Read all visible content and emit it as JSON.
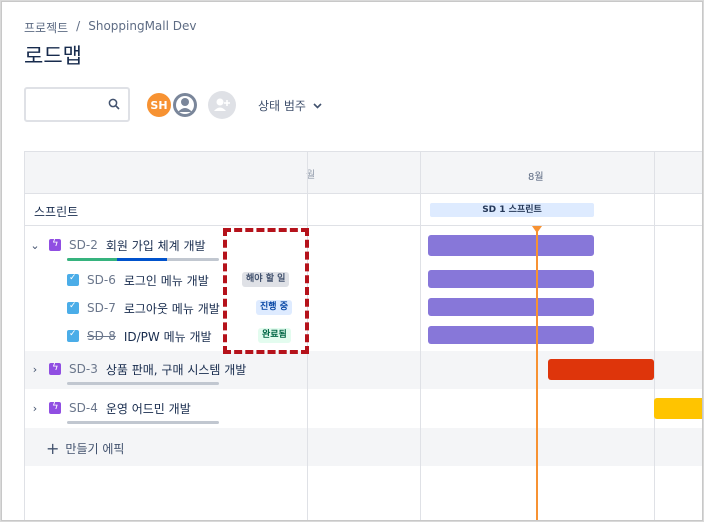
{
  "breadcrumb": {
    "project": "프로젝트",
    "separator": "/",
    "name": "ShoppingMall Dev"
  },
  "page_title": "로드맵",
  "search": {
    "placeholder": ""
  },
  "avatars": {
    "initials": "SH"
  },
  "filter": {
    "status_label": "상태 범주"
  },
  "timeline": {
    "month_partial": "월",
    "month": "8월"
  },
  "sprint": {
    "label": "스프린트",
    "chip": "SD 1 스프린트"
  },
  "epics": [
    {
      "key": "SD-2",
      "name": "회원 가입 체계 개발",
      "expanded": true,
      "bar_color": "#8777d9"
    },
    {
      "key": "SD-3",
      "name": "상품 판매, 구매 시스템 개발",
      "expanded": false,
      "bar_color": "#de350b"
    },
    {
      "key": "SD-4",
      "name": "운영 어드민 개발",
      "expanded": false,
      "bar_color": "#ffc400"
    }
  ],
  "issues": [
    {
      "key": "SD-6",
      "name": "로그인 메뉴 개발",
      "status": "해야 할 일",
      "done": false
    },
    {
      "key": "SD-7",
      "name": "로그아웃 메뉴 개발",
      "status": "진행 중",
      "done": false
    },
    {
      "key": "SD-8",
      "name": "ID/PW 메뉴 개발",
      "status": "완료됨",
      "done": true
    }
  ],
  "create_epic": {
    "icon": "+",
    "label": "만들기 에픽"
  },
  "colors": {
    "today_line": "#f79232",
    "issue_bar": "#8777d9",
    "highlight_box": "#b5121b"
  }
}
